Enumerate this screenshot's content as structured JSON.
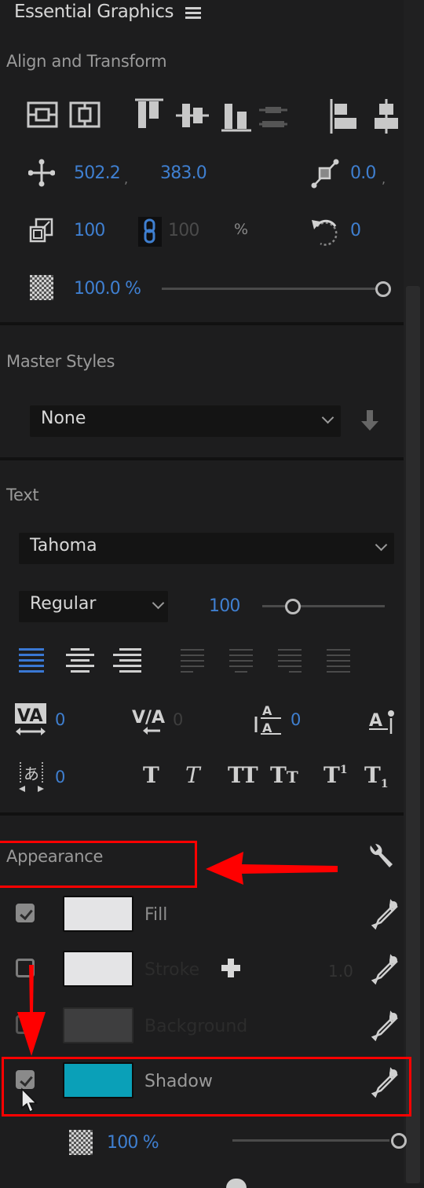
{
  "panel": {
    "title": "Essential Graphics",
    "menu_icon": "hamburger-menu-icon"
  },
  "align_transform": {
    "title": "Align and Transform",
    "align_buttons": [
      {
        "name": "align-vertical-center-frame",
        "icon": "align-vertical-frame-icon"
      },
      {
        "name": "align-horizontal-center-frame",
        "icon": "align-horizontal-frame-icon"
      },
      {
        "name": "align-top",
        "icon": "align-top-icon"
      },
      {
        "name": "align-vertical-center",
        "icon": "align-vcenter-icon"
      },
      {
        "name": "align-bottom",
        "icon": "align-bottom-icon"
      },
      {
        "name": "distribute-vertical",
        "icon": "distribute-vertical-icon",
        "disabled": true
      },
      {
        "name": "align-left",
        "icon": "align-left-icon"
      },
      {
        "name": "align-horizontal-center",
        "icon": "align-hcenter-icon"
      }
    ],
    "position": {
      "x": "502.2",
      "y": "383.0",
      "separator": ","
    },
    "anchor": {
      "x": "0.0",
      "separator": ","
    },
    "scale": {
      "width": "100",
      "height": "100",
      "unit": "%",
      "linked": true
    },
    "rotation": "0",
    "opacity": {
      "label": "100.0 %",
      "percent": 100
    }
  },
  "master_styles": {
    "title": "Master Styles",
    "selected": "None"
  },
  "text": {
    "title": "Text",
    "font_family": "Tahoma",
    "font_style": "Regular",
    "font_size": "100",
    "font_size_slider_fraction": 0.25,
    "alignment": [
      "align-left",
      "align-center",
      "align-right",
      "justify-left",
      "justify-center",
      "justify-right",
      "justify-all"
    ],
    "active_alignment": "align-left",
    "kerning": "0",
    "tracking": "0",
    "leading": "0",
    "tsume": "0",
    "styles": [
      {
        "name": "faux-bold",
        "glyph": "T"
      },
      {
        "name": "faux-italic",
        "glyph": "T"
      },
      {
        "name": "all-caps",
        "glyph": "TT"
      },
      {
        "name": "small-caps",
        "glyph": "Tт"
      },
      {
        "name": "superscript",
        "glyph": "T¹"
      },
      {
        "name": "subscript",
        "glyph": "T₁"
      }
    ]
  },
  "appearance": {
    "title": "Appearance",
    "layers": [
      {
        "label": "Fill",
        "checked": true,
        "color": "#e4e4e6",
        "enabled": true
      },
      {
        "label": "Stroke",
        "checked": false,
        "color": "#e4e4e6",
        "enabled": false,
        "width": "1.0"
      },
      {
        "label": "Background",
        "checked": false,
        "color": "#3e3e3f",
        "enabled": false
      },
      {
        "label": "Shadow",
        "checked": true,
        "color": "#0aa0b8",
        "enabled": true
      }
    ],
    "shadow_opacity": {
      "label": "100 %",
      "percent": 100
    }
  },
  "annotations": {
    "highlight_color": "#ff0000"
  }
}
